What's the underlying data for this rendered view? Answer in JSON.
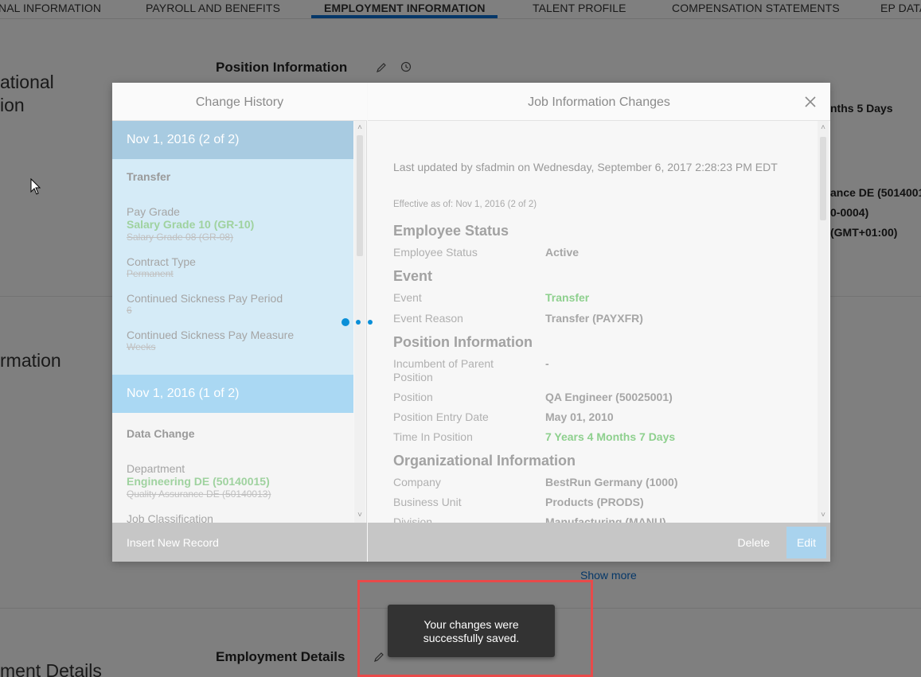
{
  "tabs": [
    {
      "label": "NAL INFORMATION"
    },
    {
      "label": "PAYROLL AND BENEFITS"
    },
    {
      "label": "EMPLOYMENT INFORMATION"
    },
    {
      "label": "TALENT PROFILE"
    },
    {
      "label": "COMPENSATION STATEMENTS"
    },
    {
      "label": "EP DATA"
    }
  ],
  "background": {
    "left_titles": [
      "ational",
      "ion",
      "rmation",
      "ment Details"
    ],
    "position_heading": "Position Information",
    "employment_heading": "Employment Details",
    "right_snippets": [
      "nths 5 Days",
      "ance DE (5014001",
      "0-0004)",
      "(GMT+01:00)"
    ],
    "show_more": "Show more"
  },
  "dialog": {
    "left_title": "Change History",
    "right_title": "Job Information Changes",
    "history": [
      {
        "date": "Nov 1, 2016 (2 of 2)",
        "event": "Transfer",
        "changes": [
          {
            "label": "Pay Grade",
            "new": "Salary Grade 10 (GR-10)",
            "old": "Salary Grade 08 (GR-08)"
          },
          {
            "label": "Contract Type",
            "new": "",
            "old": "Permanent"
          },
          {
            "label": "Continued Sickness Pay Period",
            "new": "",
            "old": "6"
          },
          {
            "label": "Continued Sickness Pay Measure",
            "new": "",
            "old": "Weeks"
          }
        ]
      },
      {
        "date": "Nov 1, 2016 (1 of 2)",
        "event": "Data Change",
        "changes": [
          {
            "label": "Department",
            "new": "Engineering DE (50140015)",
            "old": "Quality Assurance DE (50140013)"
          },
          {
            "label": "Job Classification",
            "new": "",
            "old": ""
          }
        ]
      }
    ],
    "insert_new_record": "Insert New Record",
    "last_updated": "Last updated by sfadmin on Wednesday, September 6, 2017 2:28:23 PM EDT",
    "effective_as_of": "Effective as of: Nov 1, 2016 (2 of 2)",
    "sections": {
      "employee_status": {
        "title": "Employee Status",
        "fields": [
          {
            "label": "Employee Status",
            "value": "Active"
          }
        ]
      },
      "event": {
        "title": "Event",
        "fields": [
          {
            "label": "Event",
            "value": "Transfer"
          },
          {
            "label": "Event Reason",
            "value": "Transfer (PAYXFR)"
          }
        ]
      },
      "position": {
        "title": "Position Information",
        "fields": [
          {
            "label": "Incumbent of Parent Position",
            "value": "-"
          },
          {
            "label": "Position",
            "value": "QA Engineer (50025001)"
          },
          {
            "label": "Position Entry Date",
            "value": "May 01, 2010"
          },
          {
            "label": "Time In Position",
            "value": "7 Years 4 Months 7 Days"
          }
        ]
      },
      "org": {
        "title": "Organizational Information",
        "fields": [
          {
            "label": "Company",
            "value": "BestRun Germany (1000)"
          },
          {
            "label": "Business Unit",
            "value": "Products (PRODS)"
          },
          {
            "label": "Division",
            "value": "Manufacturing (MANU)"
          }
        ]
      }
    },
    "delete_label": "Delete",
    "edit_label": "Edit"
  },
  "toast": {
    "line1": "Your changes were",
    "line2": "successfully saved."
  },
  "colors": {
    "accent": "#0a6ed1",
    "history_head": "#a8cbe1",
    "history_body": "#d5ebf7",
    "new_value": "#9fd29f",
    "toast_bg": "#333333",
    "highlight": "#e84a4a"
  },
  "icons": [
    "pencil-icon",
    "history-icon",
    "close-icon",
    "cursor-icon"
  ]
}
